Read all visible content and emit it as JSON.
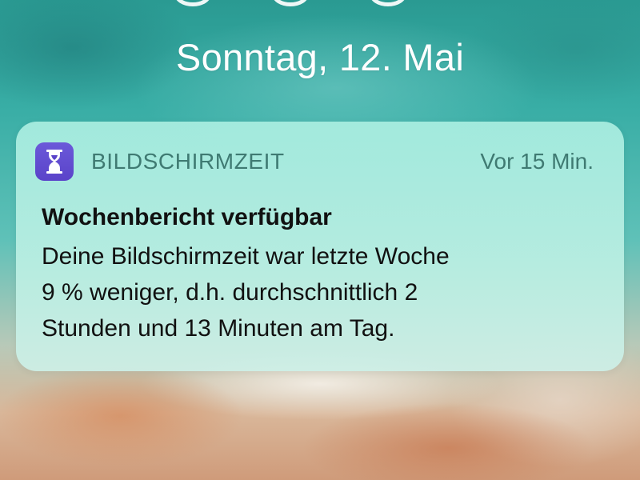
{
  "lockscreen": {
    "date": "Sonntag, 12. Mai"
  },
  "notification": {
    "app_icon": "hourglass-icon",
    "app_name": "BILDSCHIRMZEIT",
    "timestamp": "Vor 15 Min.",
    "title": "Wochenbericht verfügbar",
    "body_lines": [
      "Deine Bildschirmzeit war letzte Woche",
      "9 % weniger, d.h. durchschnittlich 2",
      "Stunden und 13 Minuten am Tag."
    ]
  },
  "colors": {
    "app_icon_bg": "#5a43c9",
    "app_name_text": "#3f7a72",
    "notification_bg": "#b4ecdf",
    "wallpaper_top": "#2a9a92",
    "wallpaper_bottom": "#cf9b7a"
  }
}
